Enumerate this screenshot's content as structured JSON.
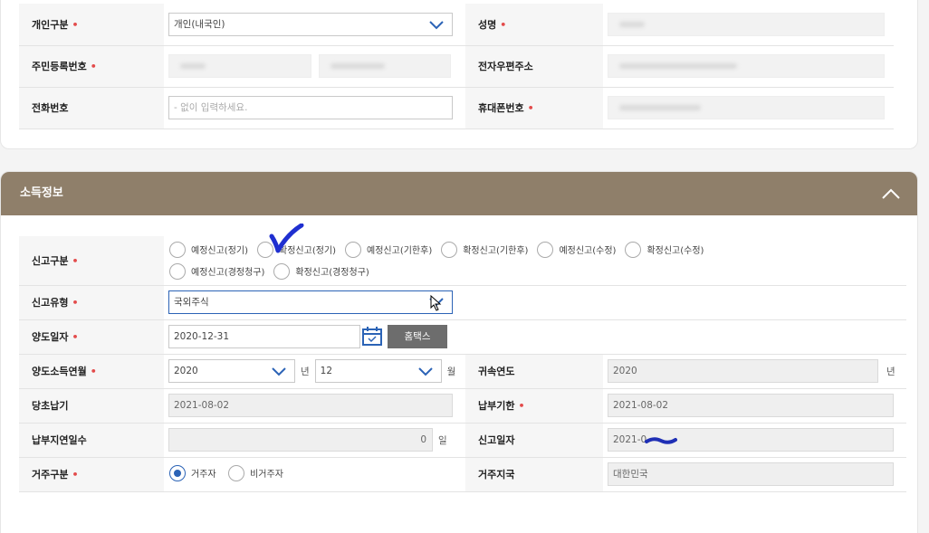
{
  "personal": {
    "type_label": "개인구분",
    "type_value": "개인(내국인)",
    "name_label": "성명",
    "rrn_label": "주민등록번호",
    "email_label": "전자우편주소",
    "phone_label": "전화번호",
    "phone_placeholder": "- 없이 입력하세요.",
    "mobile_label": "휴대폰번호",
    "required_mark": "•"
  },
  "income": {
    "section_title": "소득정보",
    "report_type_label": "신고구분",
    "report_options": [
      "예정신고(정기)",
      "확정신고(정기)",
      "예정신고(기한후)",
      "확정신고(기한후)",
      "예정신고(수정)",
      "확정신고(수정)",
      "예정신고(경정청구)",
      "확정신고(경정청구)"
    ],
    "report_kind_label": "신고유형",
    "report_kind_value": "국외주식",
    "transfer_date_label": "양도일자",
    "transfer_date_value": "2020-12-31",
    "hometax_button": "홈택스",
    "income_month_label": "양도소득연월",
    "year_value": "2020",
    "year_unit": "년",
    "month_value": "12",
    "month_unit": "월",
    "attribution_year_label": "귀속연도",
    "attribution_year_value": "2020",
    "attribution_year_unit": "년",
    "original_due_label": "당초납기",
    "original_due_value": "2021-08-02",
    "payment_due_label": "납부기한",
    "payment_due_value": "2021-08-02",
    "late_days_label": "납부지연일수",
    "late_days_value": "0",
    "late_days_unit": "일",
    "report_date_label": "신고일자",
    "report_date_value": "2021-0",
    "residency_label": "거주구분",
    "residency_options": [
      "거주자",
      "비거주자"
    ],
    "residence_country_label": "거주지국",
    "residence_country_value": "대한민국"
  },
  "colors": {
    "header_bg": "#8f7f6a",
    "required": "#e34b4b",
    "accent": "#2b63b6",
    "hometax_bg": "#6d6d6d"
  }
}
